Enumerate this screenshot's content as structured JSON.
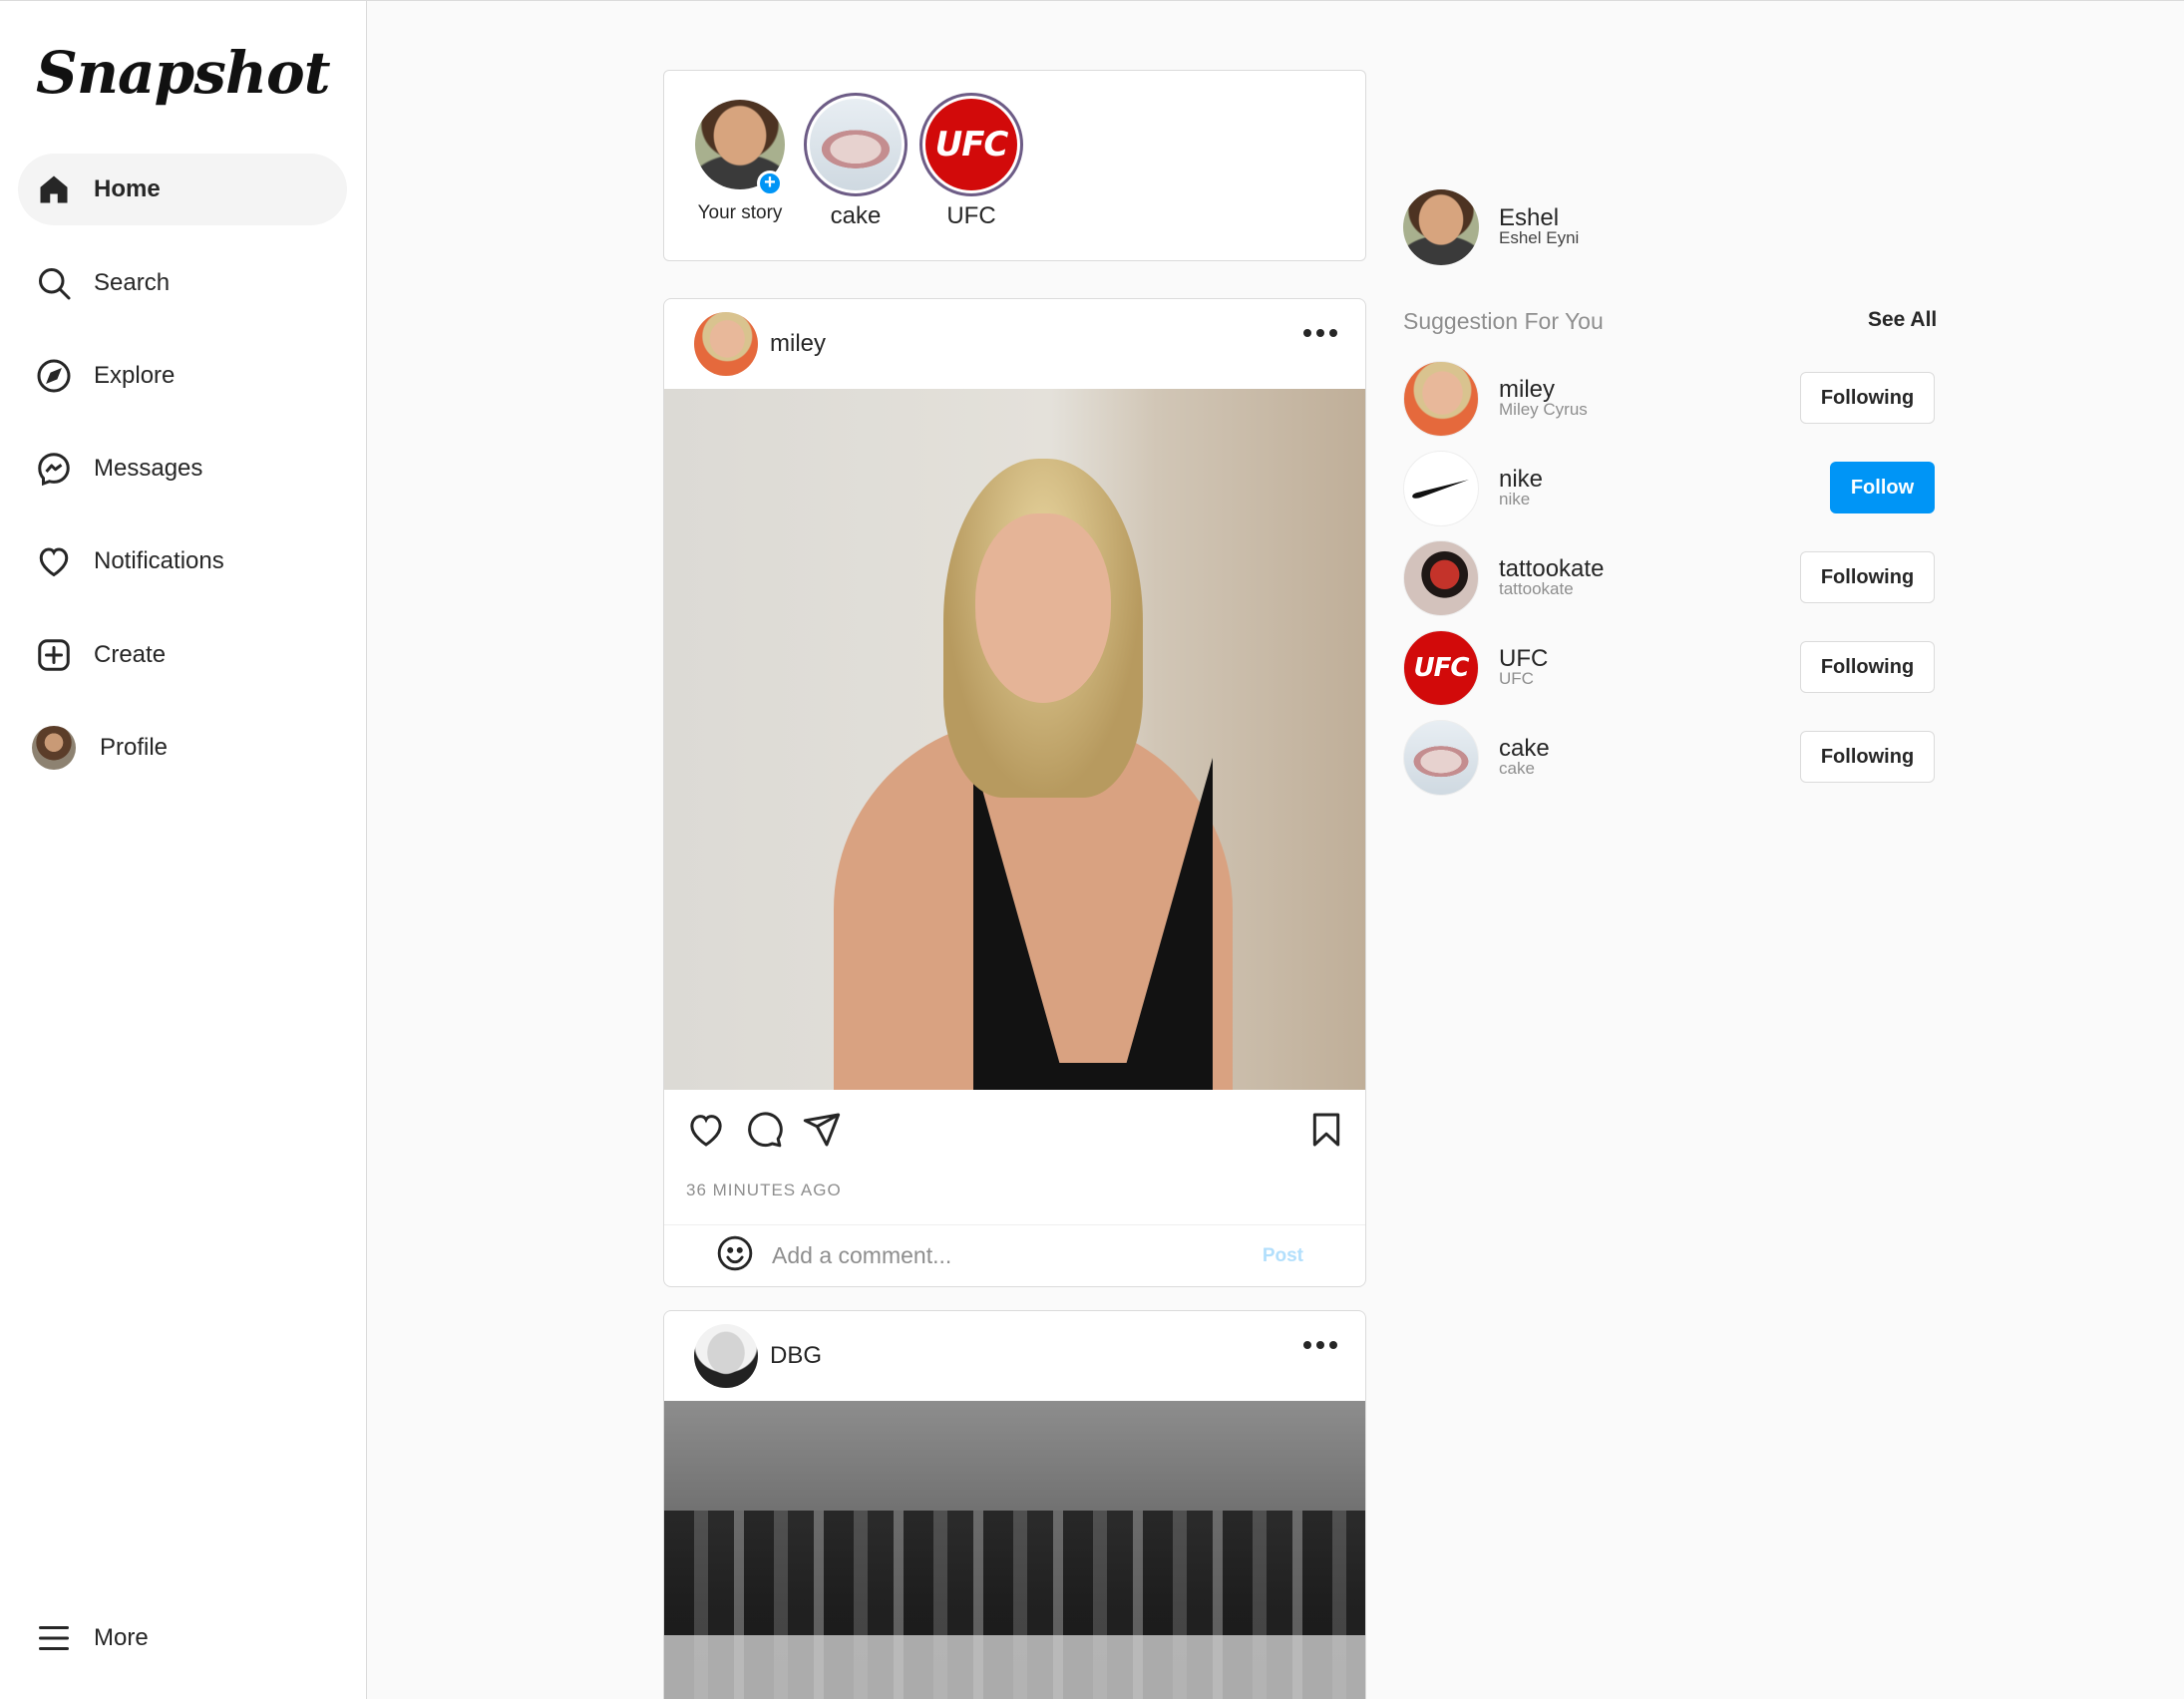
{
  "app": {
    "logo": "Snapshot"
  },
  "nav": [
    {
      "label": "Home",
      "icon": "home-icon"
    },
    {
      "label": "Search",
      "icon": "search-icon"
    },
    {
      "label": "Explore",
      "icon": "compass-icon"
    },
    {
      "label": "Messages",
      "icon": "messenger-icon"
    },
    {
      "label": "Notifications",
      "icon": "heart-icon"
    },
    {
      "label": "Create",
      "icon": "plus-square-icon"
    },
    {
      "label": "Profile",
      "icon": "avatar"
    }
  ],
  "more": {
    "label": "More",
    "icon": "menu-icon"
  },
  "stories": [
    {
      "label": "Your story"
    },
    {
      "label": "cake"
    },
    {
      "label": "UFC"
    }
  ],
  "ufc_logo_text": "UFC",
  "posts": [
    {
      "user": "miley",
      "time": "36 MINUTES AGO",
      "comment_placeholder": "Add a comment...",
      "post_label": "Post"
    },
    {
      "user": "DBG"
    }
  ],
  "me": {
    "username": "Eshel",
    "fullname": "Eshel Eyni"
  },
  "suggestions_title": "Suggestion For You",
  "see_all": "See All",
  "suggestions": [
    {
      "username": "miley",
      "fullname": "Miley Cyrus",
      "button": "Following"
    },
    {
      "username": "nike",
      "fullname": "nike",
      "button": "Follow"
    },
    {
      "username": "tattookate",
      "fullname": "tattookate",
      "button": "Following"
    },
    {
      "username": "UFC",
      "fullname": "UFC",
      "button": "Following"
    },
    {
      "username": "cake",
      "fullname": "cake",
      "button": "Following"
    }
  ],
  "colors": {
    "accent": "#0095f6",
    "ufc_red": "#d20a0a"
  }
}
